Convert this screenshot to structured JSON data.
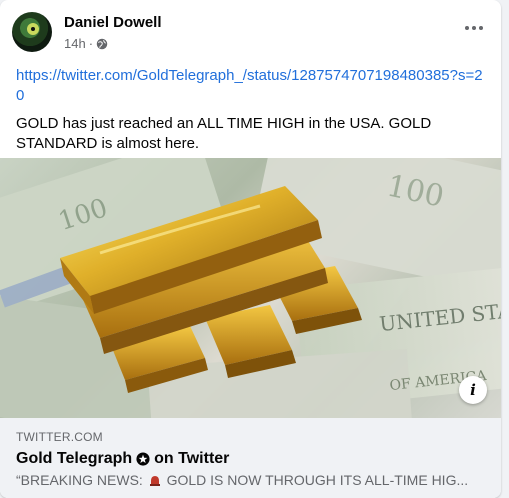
{
  "post": {
    "author": "Daniel Dowell",
    "time": "14h",
    "separator": "·",
    "icons": {
      "audience": "globe-icon",
      "menu": "more-options-icon",
      "info": "info-icon"
    },
    "link": "https://twitter.com/GoldTelegraph_/status/1287574707198480385?s=20",
    "text": "GOLD has just reached an ALL TIME HIGH in the USA. GOLD STANDARD is almost here."
  },
  "preview": {
    "domain": "TWITTER.COM",
    "title_before": "Gold Telegraph",
    "title_after": "on Twitter",
    "description_quote_open": "“BREAKING NEWS:",
    "description_rest": "GOLD IS NOW THROUGH ITS ALL-TIME HIG..."
  },
  "colors": {
    "link": "#216fdb",
    "secondary_text": "#65676b",
    "preview_bg": "#f0f2f5"
  }
}
